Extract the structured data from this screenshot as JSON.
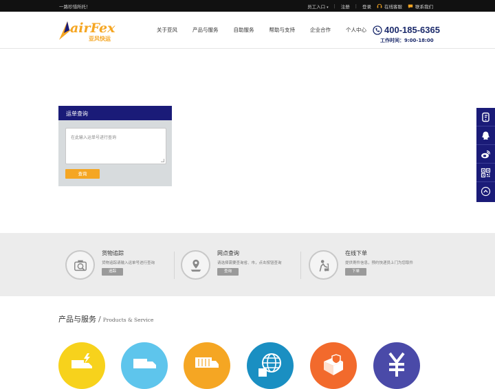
{
  "topbar": {
    "slogan": "一路珍惜所托！",
    "staff_entry": "员工入口",
    "register": "注册",
    "login": "登录",
    "online_service": "在线客服",
    "contact_us": "联系我们"
  },
  "brand": {
    "logo_text": "airFex",
    "logo_sub": "亚风快运",
    "colors": {
      "navy": "#1a1b78",
      "gold": "#f5a623"
    }
  },
  "nav": {
    "items": [
      {
        "label": "关于亚风"
      },
      {
        "label": "产品与服务"
      },
      {
        "label": "自助服务"
      },
      {
        "label": "帮助与支持"
      },
      {
        "label": "企业合作"
      },
      {
        "label": "个人中心"
      }
    ]
  },
  "contact": {
    "phone": "400-185-6365",
    "hours": "工作时间：9:00-18:00"
  },
  "tracking": {
    "title": "运单查询",
    "placeholder": "在此输入运单号进行查询",
    "button": "查询"
  },
  "features": [
    {
      "title": "货物追踪",
      "desc": "货物追踪请输入运单号进行查询",
      "button": "追踪",
      "icon": "camera-search-icon"
    },
    {
      "title": "网点查询",
      "desc": "请选择需要查询省、市，点击按钮查询",
      "button": "查询",
      "icon": "map-pin-icon"
    },
    {
      "title": "在线下单",
      "desc": "提供寄件信息，预约快递员上门为您取件",
      "button": "下单",
      "icon": "courier-icon"
    }
  ],
  "products": {
    "title": "产品与服务",
    "title_en": "Products & Service",
    "circles": [
      {
        "color": "#f7d21c",
        "icon": "express-truck-icon"
      },
      {
        "color": "#5ec5ec",
        "icon": "truck-icon"
      },
      {
        "color": "#f5a623",
        "icon": "container-truck-icon"
      },
      {
        "color": "#1a8fc2",
        "icon": "globe-icon"
      },
      {
        "color": "#f26a2c",
        "icon": "shield-box-icon"
      },
      {
        "color": "#4a4aa8",
        "icon": "yen-icon"
      }
    ]
  },
  "sidebar": {
    "buttons": [
      {
        "icon": "phone-chat-icon"
      },
      {
        "icon": "qq-icon"
      },
      {
        "icon": "weibo-icon"
      },
      {
        "icon": "qrcode-icon"
      },
      {
        "icon": "back-to-top-icon"
      }
    ]
  }
}
